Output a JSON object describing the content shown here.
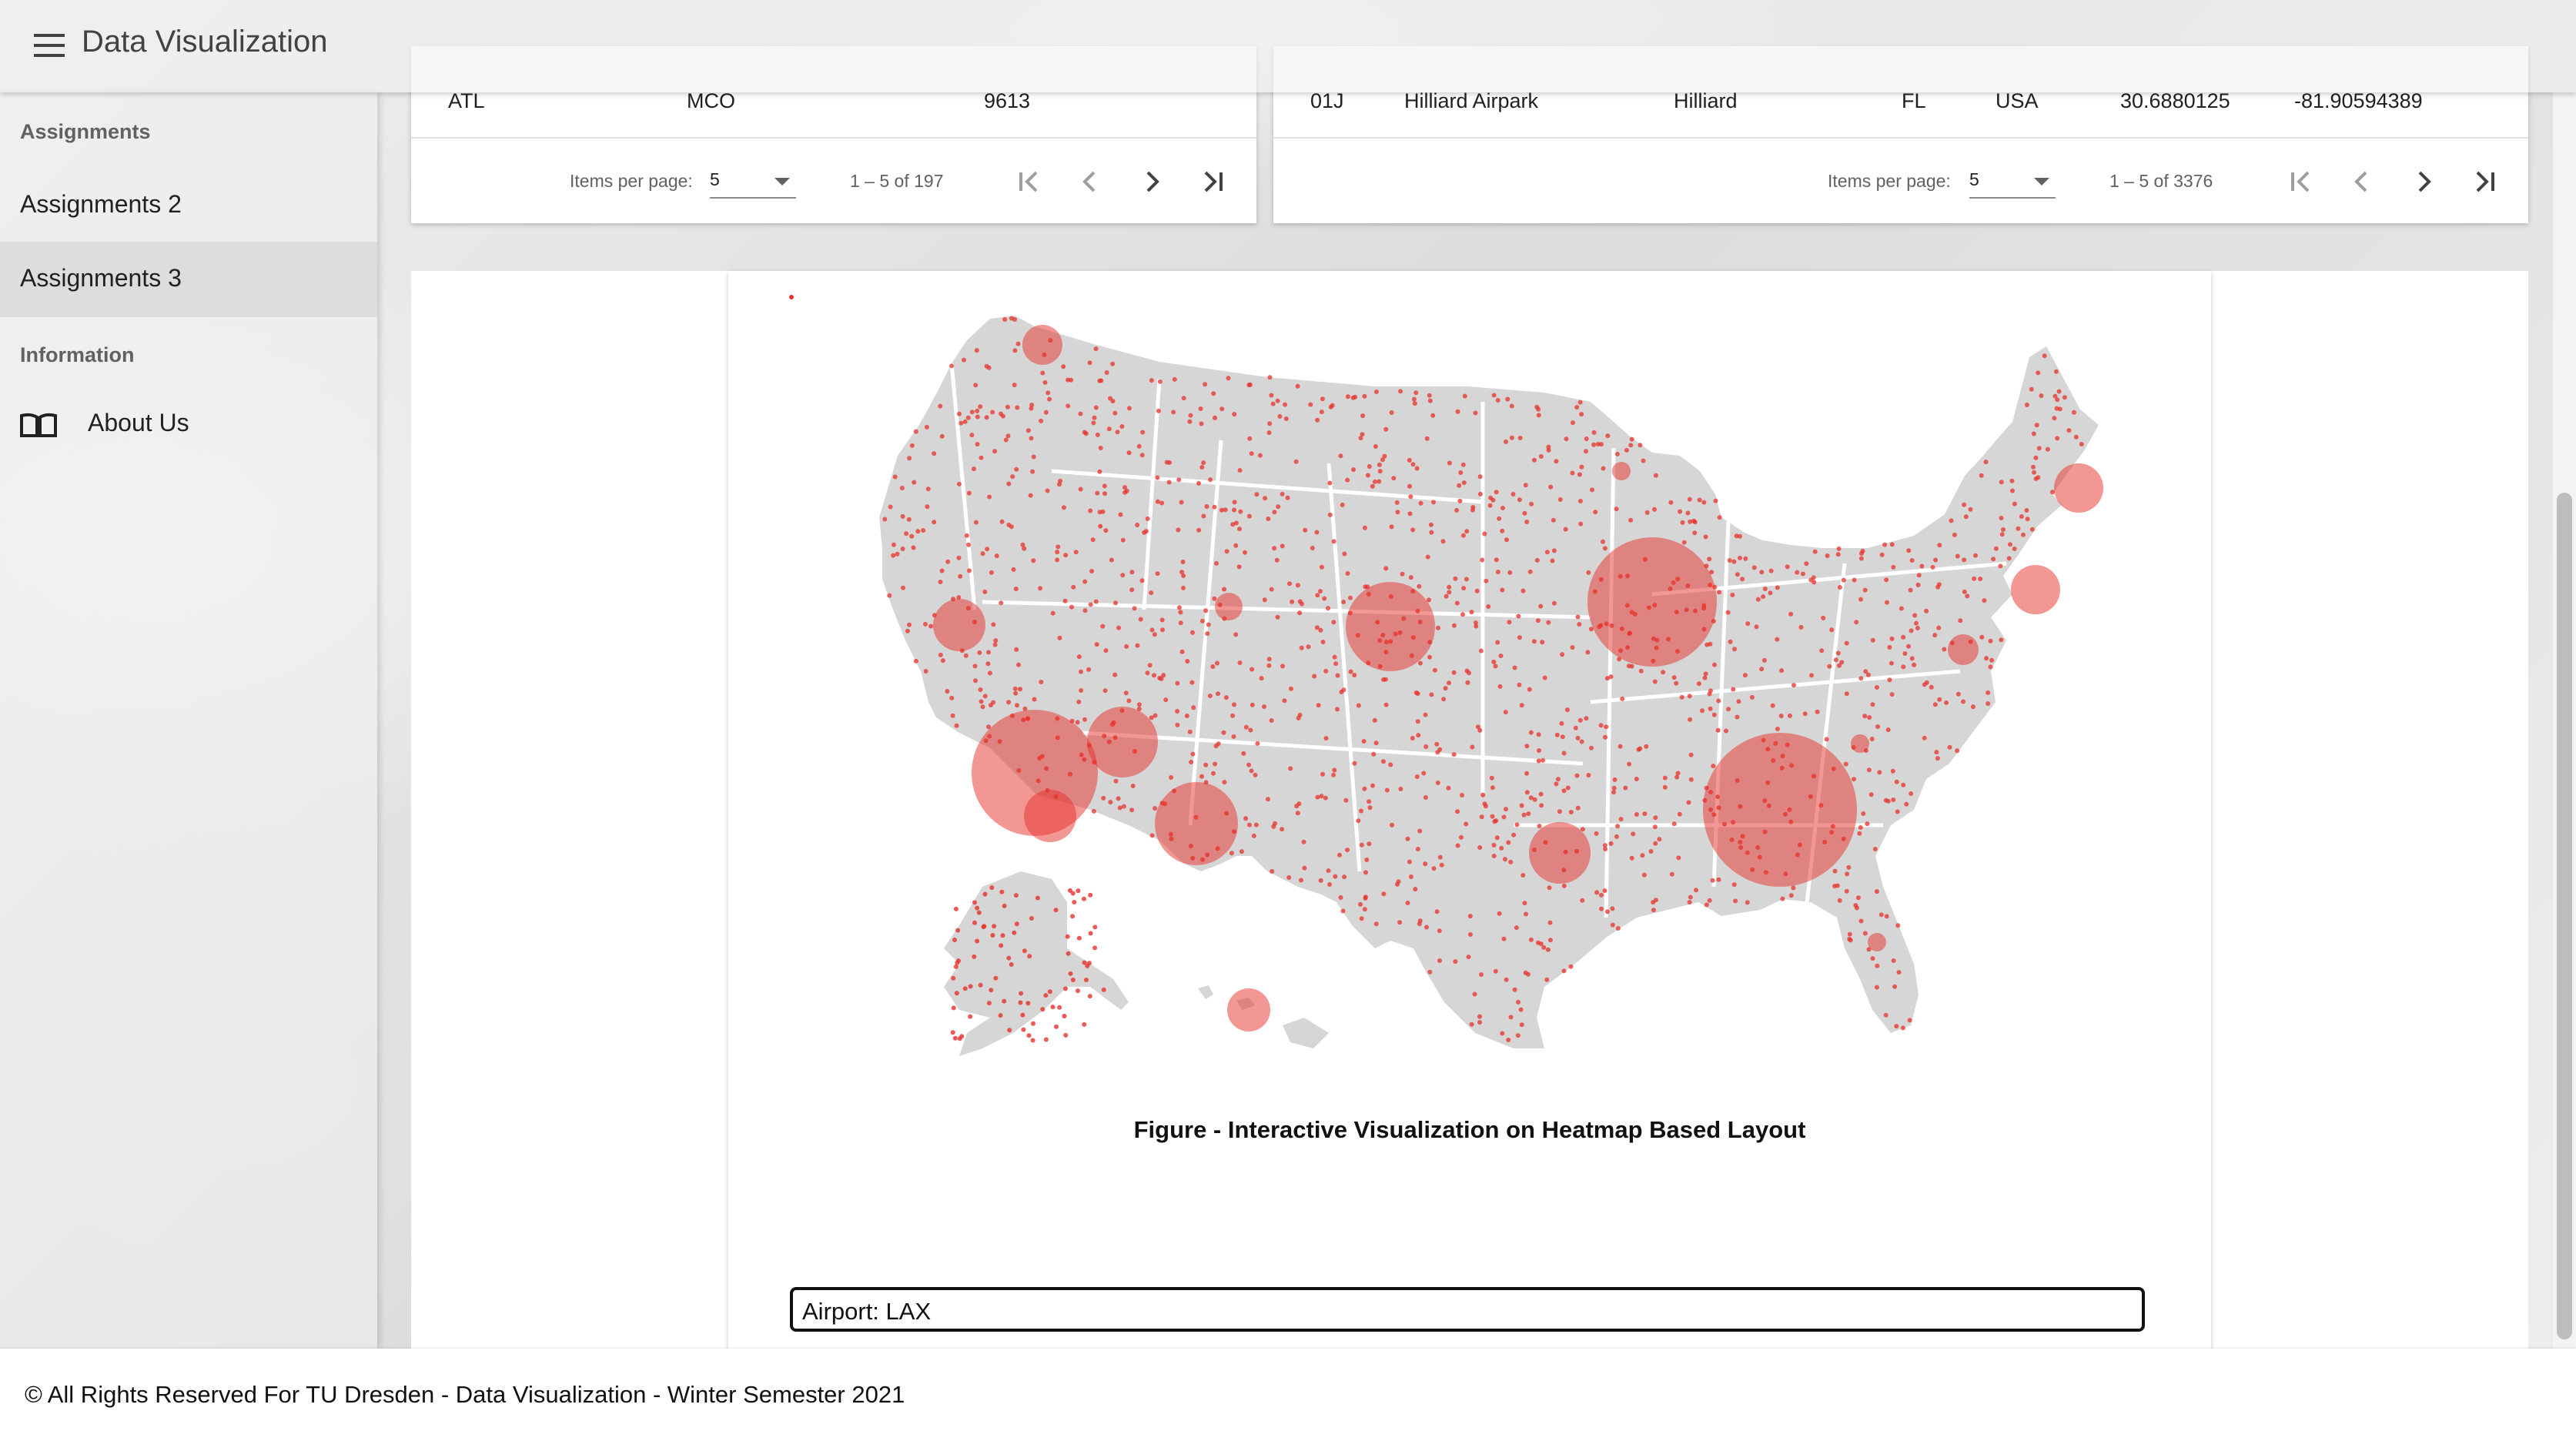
{
  "app": {
    "title": "Data Visualization"
  },
  "sidebar": {
    "sections": [
      {
        "heading": "Assignments",
        "items": [
          {
            "label": "Assignments 2"
          },
          {
            "label": "Assignments 3"
          }
        ]
      },
      {
        "heading": "Information",
        "items": [
          {
            "label": "About Us",
            "icon": "book-icon"
          }
        ]
      }
    ]
  },
  "routes_table": {
    "row": [
      "ATL",
      "MCO",
      "9613"
    ],
    "items_per_page_label": "Items per page:",
    "items_per_page": "5",
    "range": "1 – 5 of 197"
  },
  "airports_table": {
    "row": [
      "01J",
      "Hilliard Airpark",
      "Hilliard",
      "FL",
      "USA",
      "30.6880125",
      "-81.90594389"
    ],
    "items_per_page_label": "Items per page:",
    "items_per_page": "5",
    "range": "1 – 5 of 3376"
  },
  "figure": {
    "caption": "Figure - Interactive Visualization on Heatmap Based Layout",
    "selected_airport": "Airport: LAX",
    "colors": {
      "land": "#d6d6d6",
      "border": "#ffffff",
      "marker": "#e8302a"
    }
  },
  "footer": {
    "text": "© All Rights Reserved For TU Dresden - Data Visualization - Winter Semester 2021"
  }
}
